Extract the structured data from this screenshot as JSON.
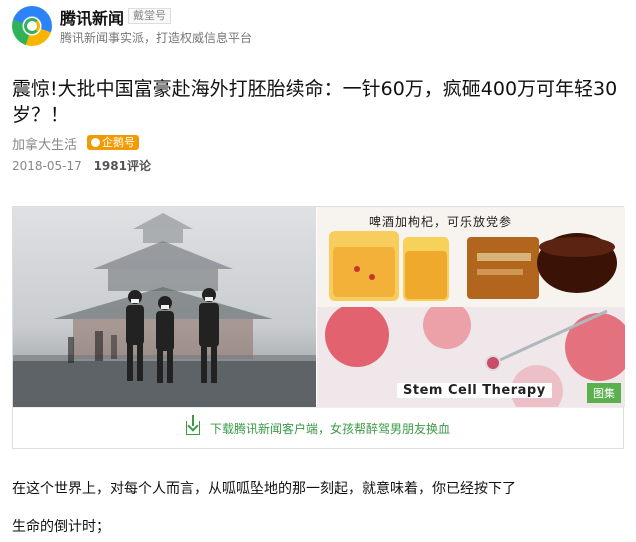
{
  "header": {
    "brand": "腾讯新闻",
    "brand_tag": "戴堂号",
    "subtitle": "腾讯新闻事实派，打造权威信息平台"
  },
  "article": {
    "title": "震惊!大批中国富豪赴海外打胚胎续命：一针60万，疯砸400万可年轻30岁？！",
    "author": "加拿大生活",
    "author_badge": "企鹅号",
    "date": "2018-05-17",
    "comments": "1981评论"
  },
  "media": {
    "drink_caption": "啤酒加枸杞，可乐放党参",
    "stem_label": "Stem Cell Therapy",
    "gallery_tag": "图集",
    "download_text": "下载腾讯新闻客户端，女孩帮醉驾男朋友换血"
  },
  "body": {
    "paragraph1": "在这个世界上，对每个人而言，从呱呱坠地的那一刻起，就意味着，你已经按下了",
    "paragraph2": "生命的倒计时；"
  },
  "colors": {
    "accent_green": "#3a9a46",
    "badge_orange": "#f29b00",
    "gallery_green": "#59b04c"
  }
}
